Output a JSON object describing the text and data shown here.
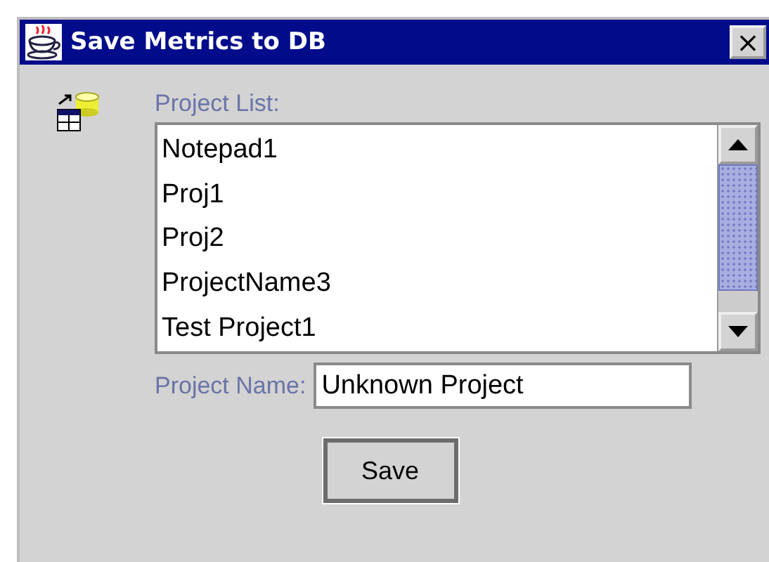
{
  "window": {
    "title": "Save Metrics to DB",
    "close": "×"
  },
  "project_list": {
    "label": "Project List:",
    "items": [
      {
        "label": "Notepad1",
        "selected": false
      },
      {
        "label": "Proj1",
        "selected": false
      },
      {
        "label": "Proj2",
        "selected": false
      },
      {
        "label": "ProjectName3",
        "selected": false
      },
      {
        "label": "Test Project1",
        "selected": false
      }
    ]
  },
  "project_name": {
    "label": "Project Name:",
    "value": "Unknown Project"
  },
  "buttons": [
    {
      "label": "Save"
    }
  ]
}
